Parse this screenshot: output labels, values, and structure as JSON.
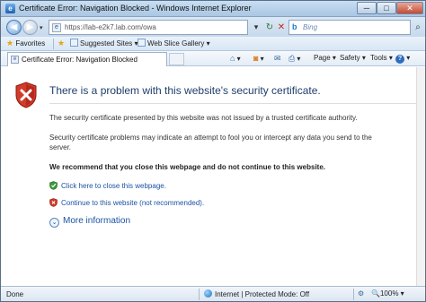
{
  "window": {
    "title": "Certificate Error: Navigation Blocked - Windows Internet Explorer",
    "minimize": "─",
    "maximize": "□",
    "close": "✕"
  },
  "address_bar": {
    "url": "https://lab-e2k7.lab.com/owa",
    "search_placeholder": "Bing",
    "icons": [
      "back-icon",
      "forward-icon",
      "page-icon",
      "compatibility-icon",
      "refresh-icon",
      "stop-icon",
      "bing-icon",
      "search-icon"
    ]
  },
  "favorites_bar": {
    "favorites_label": "Favorites",
    "items": [
      {
        "label": "Suggested Sites ▾"
      },
      {
        "label": "Web Slice Gallery ▾"
      }
    ]
  },
  "tab_bar": {
    "active_tab": "Certificate Error: Navigation Blocked",
    "commands": [
      {
        "label": "Page ▾"
      },
      {
        "label": "Safety ▾"
      },
      {
        "label": "Tools ▾"
      },
      {
        "label": "?"
      }
    ]
  },
  "content": {
    "heading": "There is a problem with this website's security certificate.",
    "paragraph1": "The security certificate presented by this website was not issued by a trusted certificate authority.",
    "paragraph2": "Security certificate problems may indicate an attempt to fool you or intercept any data you send to the server.",
    "recommendation": "We recommend that you close this webpage and do not continue to this website.",
    "close_link": "Click here to close this webpage.",
    "continue_link": "Continue to this website (not recommended).",
    "more_info": "More information"
  },
  "status_bar": {
    "status": "Done",
    "zone": "Internet | Protected Mode: Off",
    "zoom": "100%"
  },
  "colors": {
    "heading": "#1f3e6c",
    "link": "#1c52a3",
    "shield_red": "#c0281a",
    "titlebar": "#b8d1ea"
  }
}
